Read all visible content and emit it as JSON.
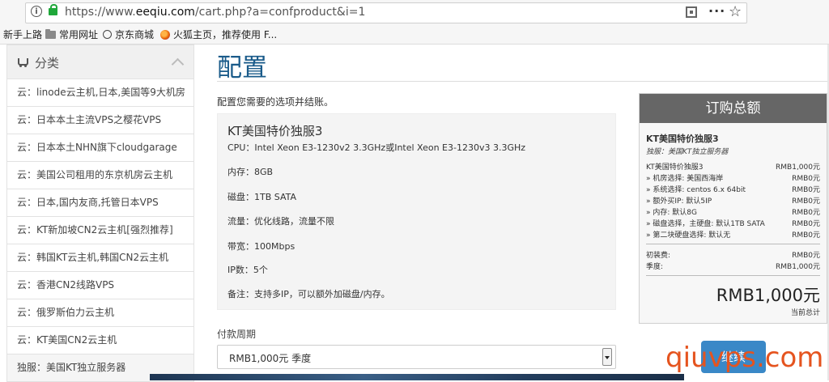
{
  "browser": {
    "url_prefix": "https://www.",
    "url_domain": "eeqiu.com",
    "url_path": "/cart.php?a=confproduct&i=1",
    "info_icon": "info-icon",
    "bookmarks": [
      "新手上路",
      "常用网址",
      "京东商城",
      "火狐主页，推荐使用 F..."
    ]
  },
  "sidebar": {
    "title": "分类",
    "items": [
      "云：linode云主机,日本,美国等9大机房",
      "云：日本本土主流VPS之樱花VPS",
      "云：日本本土NHN旗下cloudgarage",
      "云：美国公司租用的东京机房云主机",
      "云：日本,国内友商,托管日本VPS",
      "云：KT新加坡CN2云主机[强烈推荐]",
      "云：韩国KT云主机,韩国CN2云主机",
      "云：香港CN2线路VPS",
      "云：俄罗斯伯力云主机",
      "云：KT美国CN2云主机",
      "独服：美国KT独立服务器"
    ]
  },
  "main": {
    "title": "配置",
    "intro": "配置您需要的选项并结账。",
    "product_name": "KT美国特价独服3",
    "specs": [
      "CPU：Intel Xeon E3-1230v2 3.3GHz或Intel Xeon E3-1230v3 3.3GHz",
      "内存：8GB",
      "磁盘：1TB SATA",
      "流量：优化线路，流量不限",
      "带宽：100Mbps",
      "IP数：5个",
      "备注：支持多IP，可以额外加磁盘/内存。"
    ],
    "billing_label": "付款周期",
    "billing_value": "RMB1,000元 季度"
  },
  "summary": {
    "title": "订购总额",
    "product": "KT美国特价独服3",
    "group": "独服：美国KT独立服务器",
    "lines": [
      {
        "label": "KT美国特价独服3",
        "value": "RMB1,000元"
      },
      {
        "label": "» 机房选择: 美国西海岸",
        "value": "RMB0元"
      },
      {
        "label": "» 系统选择: centos 6.x 64bit",
        "value": "RMB0元"
      },
      {
        "label": "» 额外买IP: 默认5IP",
        "value": "RMB0元"
      },
      {
        "label": "» 内存: 默认8G",
        "value": "RMB0元"
      },
      {
        "label": "» 磁盘选择，主硬盘: 默认1TB SATA",
        "value": "RMB0元"
      },
      {
        "label": "» 第二块硬盘选择: 默认无",
        "value": "RMB0元"
      }
    ],
    "setup_label": "初装费:",
    "setup_value": "RMB0元",
    "recurring_label": "季度:",
    "recurring_value": "RMB1,000元",
    "total": "RMB1,000元",
    "total_label": "当前总计",
    "checkout": "继续"
  },
  "watermark": "qiuvps.com"
}
